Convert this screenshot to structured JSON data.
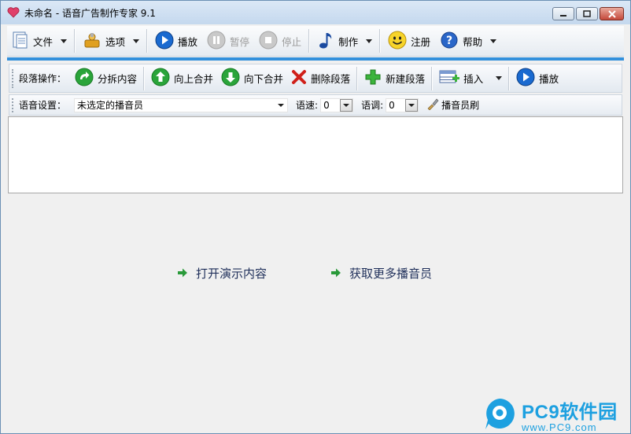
{
  "window": {
    "title": "未命名 - 语音广告制作专家 9.1"
  },
  "toolbar": {
    "file": "文件",
    "options": "选项",
    "play": "播放",
    "pause": "暂停",
    "stop": "停止",
    "make": "制作",
    "register": "注册",
    "help": "帮助"
  },
  "paragraph": {
    "label": "段落操作：",
    "split": "分拆内容",
    "merge_up": "向上合并",
    "merge_down": "向下合并",
    "delete": "删除段落",
    "new": "新建段落",
    "insert": "插入",
    "play": "播放"
  },
  "voice": {
    "label": "语音设置：",
    "speaker_value": "未选定的播音员",
    "speed_label": "语速:",
    "speed_value": "0",
    "tone_label": "语调:",
    "tone_value": "0",
    "brush": "播音员刷"
  },
  "links": {
    "open_demo": "打开演示内容",
    "get_more": "获取更多播音员"
  },
  "watermark": {
    "title": "PC9软件园",
    "url": "www.PC9.com"
  },
  "colors": {
    "accent": "#3290dc",
    "watermark": "#1da0e0"
  }
}
